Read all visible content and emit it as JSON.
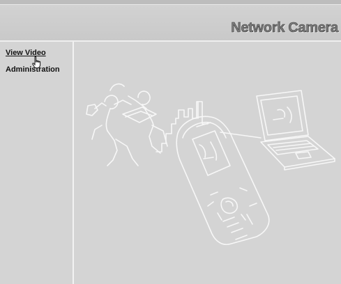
{
  "header": {
    "title": "Network Camera"
  },
  "sidebar": {
    "items": [
      {
        "label": "View Video"
      },
      {
        "label": "Administration"
      }
    ]
  },
  "colors": {
    "background": "#d4d4d4",
    "divider": "#f2f2f2",
    "title": "#7b7b7b"
  },
  "icons": [
    "hand-pointer-icon"
  ]
}
